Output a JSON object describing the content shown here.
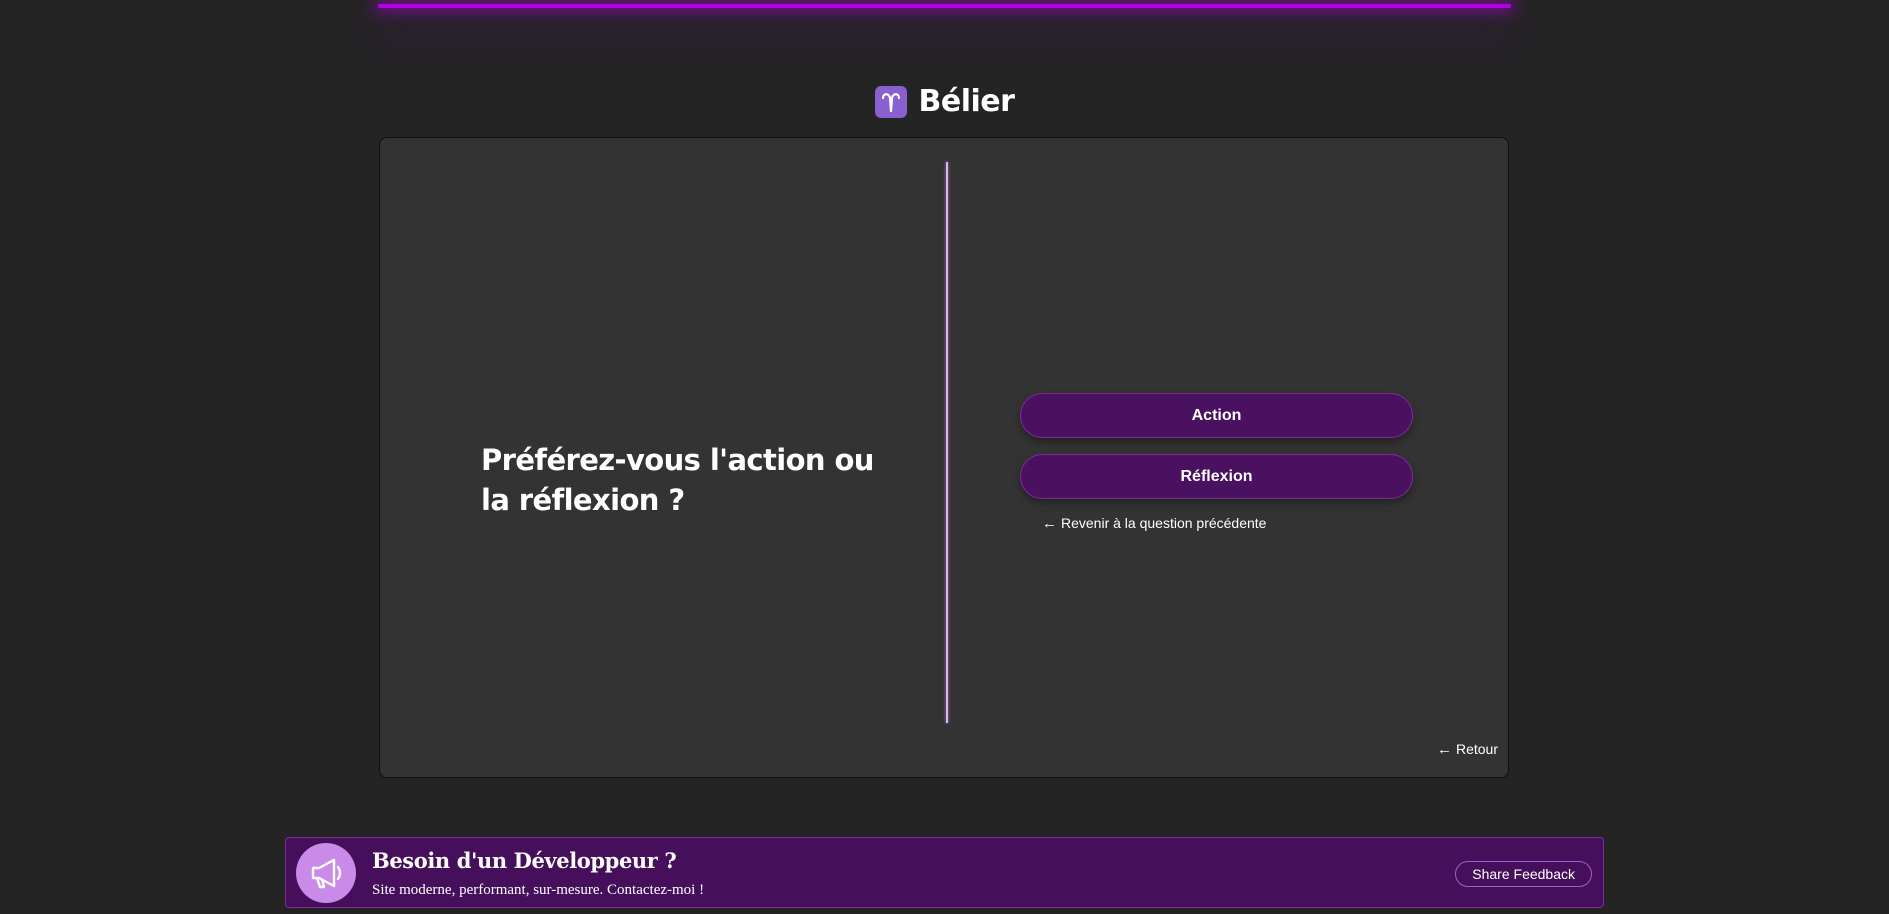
{
  "colors": {
    "background": "#242424",
    "card": "#333333",
    "accent_glow": "#b400e6",
    "button_bg": "#4a1160",
    "divider": "#e0b0ff",
    "promo_bg": "#460f5c",
    "sign_icon_bg": "#8a5fd0"
  },
  "header": {
    "sign_icon": "aries-icon",
    "title": "Bélier"
  },
  "quiz": {
    "question": "Préférez-vous l'action ou la réflexion ?",
    "answers": [
      "Action",
      "Réflexion"
    ],
    "previous_label": "Revenir à la question précédente",
    "back_label": "Retour"
  },
  "promo": {
    "icon": "megaphone-icon",
    "title": "Besoin d'un Développeur ?",
    "subtitle": "Site moderne, performant, sur-mesure. Contactez-moi !",
    "feedback_label": "Share Feedback"
  }
}
